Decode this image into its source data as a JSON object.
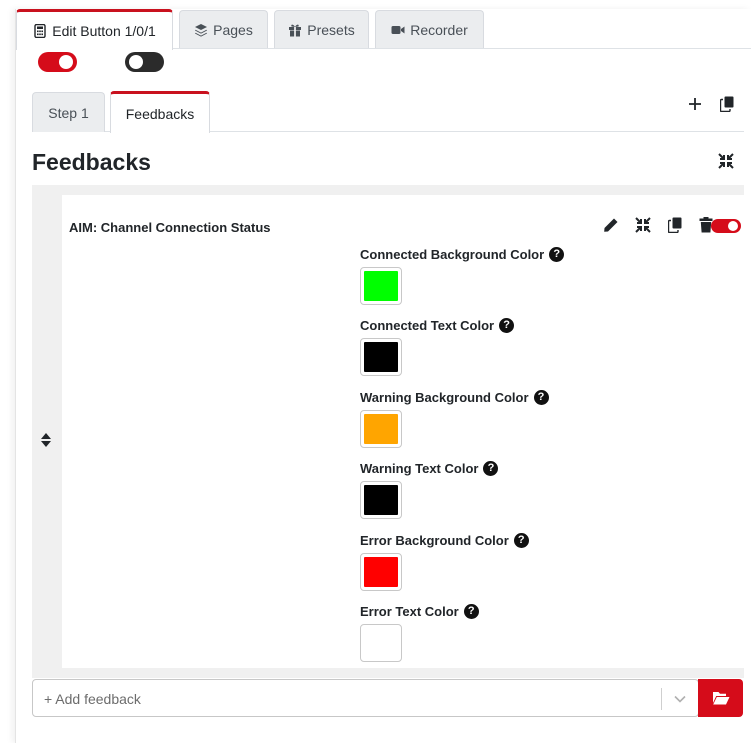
{
  "top_tabs": [
    {
      "label": "Edit Button 1/0/1",
      "icon": "calculator-icon",
      "active": true
    },
    {
      "label": "Pages",
      "icon": "layers-icon",
      "active": false
    },
    {
      "label": "Presets",
      "icon": "gift-icon",
      "active": false
    },
    {
      "label": "Recorder",
      "icon": "video-camera-icon",
      "active": false
    }
  ],
  "toggles": {
    "first": "on",
    "second": "off"
  },
  "step_tabs": [
    {
      "label": "Step 1",
      "active": false
    },
    {
      "label": "Feedbacks",
      "active": true
    }
  ],
  "section": {
    "title": "Feedbacks"
  },
  "feedback": {
    "name": "AIM: Channel Connection Status",
    "enabled": true,
    "fields": [
      {
        "label": "Connected Background Color",
        "color": "#00ff00"
      },
      {
        "label": "Connected Text Color",
        "color": "#000000"
      },
      {
        "label": "Warning Background Color",
        "color": "#ffa500"
      },
      {
        "label": "Warning Text Color",
        "color": "#000000"
      },
      {
        "label": "Error Background Color",
        "color": "#ff0000"
      },
      {
        "label": "Error Text Color",
        "color": "#ffffff"
      }
    ]
  },
  "add_feedback": {
    "placeholder": "+ Add feedback"
  },
  "colors": {
    "accent": "#d50c1a"
  }
}
